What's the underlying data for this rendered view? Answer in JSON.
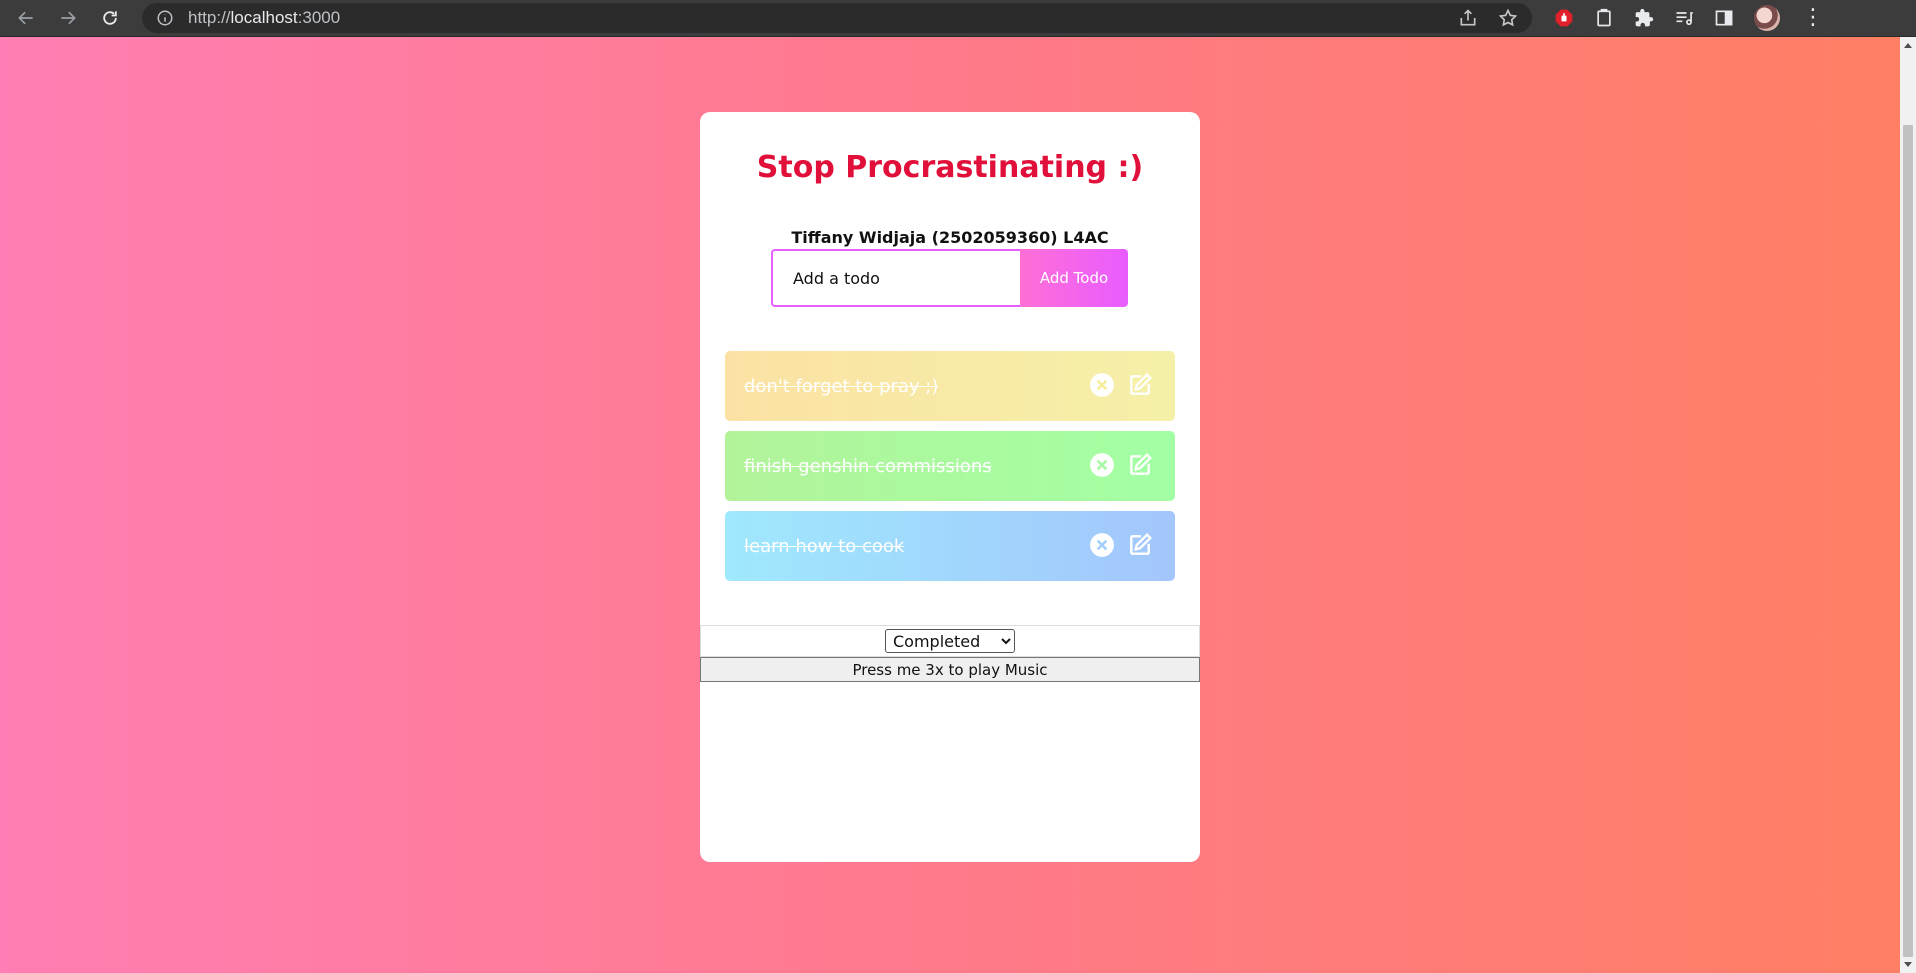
{
  "browser": {
    "url_scheme": "http://",
    "url_host": "localhost",
    "url_port": ":3000"
  },
  "app": {
    "title": "Stop Procrastinating :)",
    "author": "Tiffany Widjaja (2502059360) L4AC",
    "input_placeholder": "Add a todo",
    "add_button": "Add Todo",
    "todos": [
      {
        "text": "don't forget to pray ;)"
      },
      {
        "text": "finish genshin commissions"
      },
      {
        "text": "learn how to cook"
      }
    ],
    "filter_selected": "Completed",
    "music_button": "Press me 3x to play Music"
  },
  "colors": {
    "title": "#e0103a",
    "accent": "#e85cff"
  }
}
